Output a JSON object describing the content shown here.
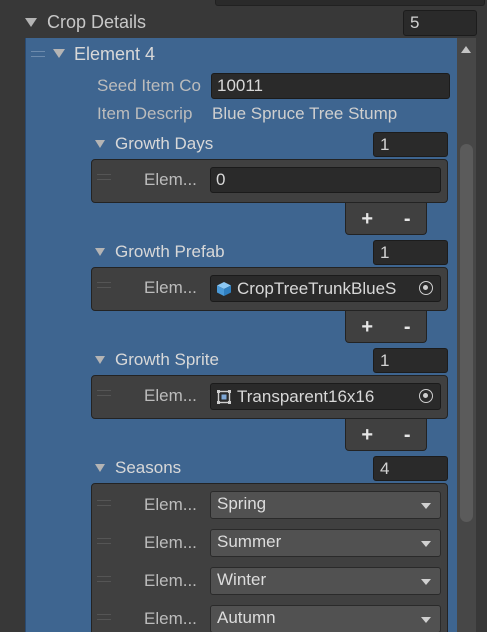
{
  "crop_details": {
    "label": "Crop Details",
    "size": "5"
  },
  "element": {
    "label": "Element 4",
    "seed_item_code_label": "Seed Item Co",
    "seed_item_code_value": "10011",
    "item_description_label": "Item Descrip",
    "item_description_value": "Blue Spruce Tree Stump"
  },
  "growth_days": {
    "label": "Growth Days",
    "size": "1",
    "items": [
      {
        "label": "Elem...",
        "value": "0"
      }
    ]
  },
  "growth_prefab": {
    "label": "Growth Prefab",
    "size": "1",
    "items": [
      {
        "label": "Elem...",
        "value": "CropTreeTrunkBlueS",
        "icon": "prefab-cube-icon"
      }
    ]
  },
  "growth_sprite": {
    "label": "Growth Sprite",
    "size": "1",
    "items": [
      {
        "label": "Elem...",
        "value": "Transparent16x16",
        "icon": "sprite-icon"
      }
    ]
  },
  "seasons": {
    "label": "Seasons",
    "size": "4",
    "items": [
      {
        "label": "Elem...",
        "value": "Spring"
      },
      {
        "label": "Elem...",
        "value": "Summer"
      },
      {
        "label": "Elem...",
        "value": "Winter"
      },
      {
        "label": "Elem...",
        "value": "Autumn"
      }
    ]
  },
  "buttons": {
    "add": "+",
    "remove": "-"
  },
  "colors": {
    "panel_bg": "#3e6590",
    "window_bg": "#383838",
    "field_bg": "#2a2a2a",
    "prefab_icon": "#5aa7e6"
  }
}
